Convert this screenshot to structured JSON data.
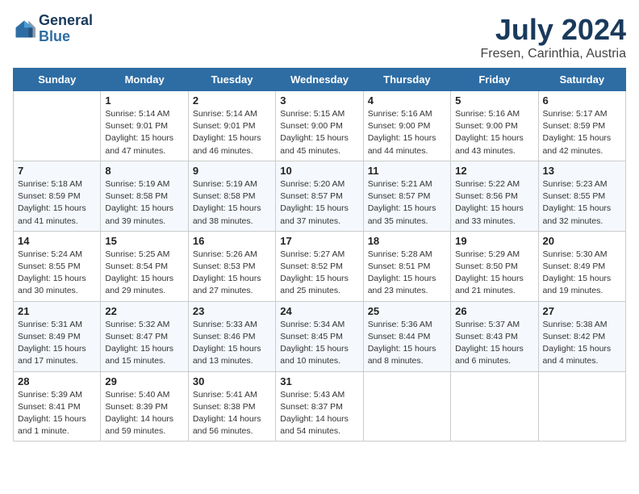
{
  "header": {
    "logo_line1": "General",
    "logo_line2": "Blue",
    "month_year": "July 2024",
    "location": "Fresen, Carinthia, Austria"
  },
  "weekdays": [
    "Sunday",
    "Monday",
    "Tuesday",
    "Wednesday",
    "Thursday",
    "Friday",
    "Saturday"
  ],
  "weeks": [
    [
      {
        "day": "",
        "content": ""
      },
      {
        "day": "1",
        "content": "Sunrise: 5:14 AM\nSunset: 9:01 PM\nDaylight: 15 hours\nand 47 minutes."
      },
      {
        "day": "2",
        "content": "Sunrise: 5:14 AM\nSunset: 9:01 PM\nDaylight: 15 hours\nand 46 minutes."
      },
      {
        "day": "3",
        "content": "Sunrise: 5:15 AM\nSunset: 9:00 PM\nDaylight: 15 hours\nand 45 minutes."
      },
      {
        "day": "4",
        "content": "Sunrise: 5:16 AM\nSunset: 9:00 PM\nDaylight: 15 hours\nand 44 minutes."
      },
      {
        "day": "5",
        "content": "Sunrise: 5:16 AM\nSunset: 9:00 PM\nDaylight: 15 hours\nand 43 minutes."
      },
      {
        "day": "6",
        "content": "Sunrise: 5:17 AM\nSunset: 8:59 PM\nDaylight: 15 hours\nand 42 minutes."
      }
    ],
    [
      {
        "day": "7",
        "content": "Sunrise: 5:18 AM\nSunset: 8:59 PM\nDaylight: 15 hours\nand 41 minutes."
      },
      {
        "day": "8",
        "content": "Sunrise: 5:19 AM\nSunset: 8:58 PM\nDaylight: 15 hours\nand 39 minutes."
      },
      {
        "day": "9",
        "content": "Sunrise: 5:19 AM\nSunset: 8:58 PM\nDaylight: 15 hours\nand 38 minutes."
      },
      {
        "day": "10",
        "content": "Sunrise: 5:20 AM\nSunset: 8:57 PM\nDaylight: 15 hours\nand 37 minutes."
      },
      {
        "day": "11",
        "content": "Sunrise: 5:21 AM\nSunset: 8:57 PM\nDaylight: 15 hours\nand 35 minutes."
      },
      {
        "day": "12",
        "content": "Sunrise: 5:22 AM\nSunset: 8:56 PM\nDaylight: 15 hours\nand 33 minutes."
      },
      {
        "day": "13",
        "content": "Sunrise: 5:23 AM\nSunset: 8:55 PM\nDaylight: 15 hours\nand 32 minutes."
      }
    ],
    [
      {
        "day": "14",
        "content": "Sunrise: 5:24 AM\nSunset: 8:55 PM\nDaylight: 15 hours\nand 30 minutes."
      },
      {
        "day": "15",
        "content": "Sunrise: 5:25 AM\nSunset: 8:54 PM\nDaylight: 15 hours\nand 29 minutes."
      },
      {
        "day": "16",
        "content": "Sunrise: 5:26 AM\nSunset: 8:53 PM\nDaylight: 15 hours\nand 27 minutes."
      },
      {
        "day": "17",
        "content": "Sunrise: 5:27 AM\nSunset: 8:52 PM\nDaylight: 15 hours\nand 25 minutes."
      },
      {
        "day": "18",
        "content": "Sunrise: 5:28 AM\nSunset: 8:51 PM\nDaylight: 15 hours\nand 23 minutes."
      },
      {
        "day": "19",
        "content": "Sunrise: 5:29 AM\nSunset: 8:50 PM\nDaylight: 15 hours\nand 21 minutes."
      },
      {
        "day": "20",
        "content": "Sunrise: 5:30 AM\nSunset: 8:49 PM\nDaylight: 15 hours\nand 19 minutes."
      }
    ],
    [
      {
        "day": "21",
        "content": "Sunrise: 5:31 AM\nSunset: 8:49 PM\nDaylight: 15 hours\nand 17 minutes."
      },
      {
        "day": "22",
        "content": "Sunrise: 5:32 AM\nSunset: 8:47 PM\nDaylight: 15 hours\nand 15 minutes."
      },
      {
        "day": "23",
        "content": "Sunrise: 5:33 AM\nSunset: 8:46 PM\nDaylight: 15 hours\nand 13 minutes."
      },
      {
        "day": "24",
        "content": "Sunrise: 5:34 AM\nSunset: 8:45 PM\nDaylight: 15 hours\nand 10 minutes."
      },
      {
        "day": "25",
        "content": "Sunrise: 5:36 AM\nSunset: 8:44 PM\nDaylight: 15 hours\nand 8 minutes."
      },
      {
        "day": "26",
        "content": "Sunrise: 5:37 AM\nSunset: 8:43 PM\nDaylight: 15 hours\nand 6 minutes."
      },
      {
        "day": "27",
        "content": "Sunrise: 5:38 AM\nSunset: 8:42 PM\nDaylight: 15 hours\nand 4 minutes."
      }
    ],
    [
      {
        "day": "28",
        "content": "Sunrise: 5:39 AM\nSunset: 8:41 PM\nDaylight: 15 hours\nand 1 minute."
      },
      {
        "day": "29",
        "content": "Sunrise: 5:40 AM\nSunset: 8:39 PM\nDaylight: 14 hours\nand 59 minutes."
      },
      {
        "day": "30",
        "content": "Sunrise: 5:41 AM\nSunset: 8:38 PM\nDaylight: 14 hours\nand 56 minutes."
      },
      {
        "day": "31",
        "content": "Sunrise: 5:43 AM\nSunset: 8:37 PM\nDaylight: 14 hours\nand 54 minutes."
      },
      {
        "day": "",
        "content": ""
      },
      {
        "day": "",
        "content": ""
      },
      {
        "day": "",
        "content": ""
      }
    ]
  ]
}
